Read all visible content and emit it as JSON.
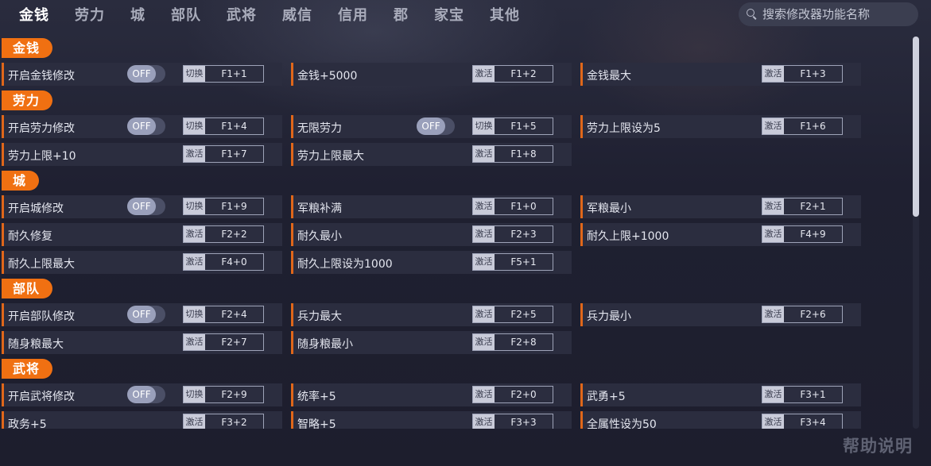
{
  "nav": {
    "tabs": [
      "金钱",
      "劳力",
      "城",
      "部队",
      "武将",
      "威信",
      "信用",
      "郡",
      "家宝",
      "其他"
    ],
    "active_index": 0
  },
  "search": {
    "placeholder": "搜索修改器功能名称"
  },
  "sections": [
    {
      "title": "金钱",
      "rows": [
        [
          {
            "label": "开启金钱修改",
            "toggle": "OFF",
            "mode": "切换",
            "key": "F1+1"
          },
          {
            "label": "金钱+5000",
            "mode": "激活",
            "key": "F1+2"
          },
          {
            "label": "金钱最大",
            "mode": "激活",
            "key": "F1+3"
          }
        ]
      ]
    },
    {
      "title": "劳力",
      "rows": [
        [
          {
            "label": "开启劳力修改",
            "toggle": "OFF",
            "mode": "切换",
            "key": "F1+4"
          },
          {
            "label": "无限劳力",
            "toggle": "OFF",
            "mode": "切换",
            "key": "F1+5"
          },
          {
            "label": "劳力上限设为5",
            "mode": "激活",
            "key": "F1+6"
          }
        ],
        [
          {
            "label": "劳力上限+10",
            "mode": "激活",
            "key": "F1+7"
          },
          {
            "label": "劳力上限最大",
            "mode": "激活",
            "key": "F1+8"
          }
        ]
      ]
    },
    {
      "title": "城",
      "rows": [
        [
          {
            "label": "开启城修改",
            "toggle": "OFF",
            "mode": "切换",
            "key": "F1+9"
          },
          {
            "label": "军粮补满",
            "mode": "激活",
            "key": "F1+0"
          },
          {
            "label": "军粮最小",
            "mode": "激活",
            "key": "F2+1"
          }
        ],
        [
          {
            "label": "耐久修复",
            "mode": "激活",
            "key": "F2+2"
          },
          {
            "label": "耐久最小",
            "mode": "激活",
            "key": "F2+3"
          },
          {
            "label": "耐久上限+1000",
            "mode": "激活",
            "key": "F4+9"
          }
        ],
        [
          {
            "label": "耐久上限最大",
            "mode": "激活",
            "key": "F4+0"
          },
          {
            "label": "耐久上限设为1000",
            "mode": "激活",
            "key": "F5+1"
          }
        ]
      ]
    },
    {
      "title": "部队",
      "rows": [
        [
          {
            "label": "开启部队修改",
            "toggle": "OFF",
            "mode": "切换",
            "key": "F2+4"
          },
          {
            "label": "兵力最大",
            "mode": "激活",
            "key": "F2+5"
          },
          {
            "label": "兵力最小",
            "mode": "激活",
            "key": "F2+6"
          }
        ],
        [
          {
            "label": "随身粮最大",
            "mode": "激活",
            "key": "F2+7"
          },
          {
            "label": "随身粮最小",
            "mode": "激活",
            "key": "F2+8"
          }
        ]
      ]
    },
    {
      "title": "武将",
      "rows": [
        [
          {
            "label": "开启武将修改",
            "toggle": "OFF",
            "mode": "切换",
            "key": "F2+9"
          },
          {
            "label": "统率+5",
            "mode": "激活",
            "key": "F2+0"
          },
          {
            "label": "武勇+5",
            "mode": "激活",
            "key": "F3+1"
          }
        ],
        [
          {
            "label": "政务+5",
            "mode": "激活",
            "key": "F3+2"
          },
          {
            "label": "智略+5",
            "mode": "激活",
            "key": "F3+3"
          },
          {
            "label": "全属性设为50",
            "mode": "激活",
            "key": "F3+4"
          }
        ]
      ]
    }
  ],
  "scroll": {
    "position_fraction": 0.0,
    "visible_fraction": 0.46
  },
  "help_label": "帮助说明",
  "colors": {
    "accent": "#f07012",
    "background": "#1e1f2f",
    "row_bg": "#2b2d3f"
  }
}
